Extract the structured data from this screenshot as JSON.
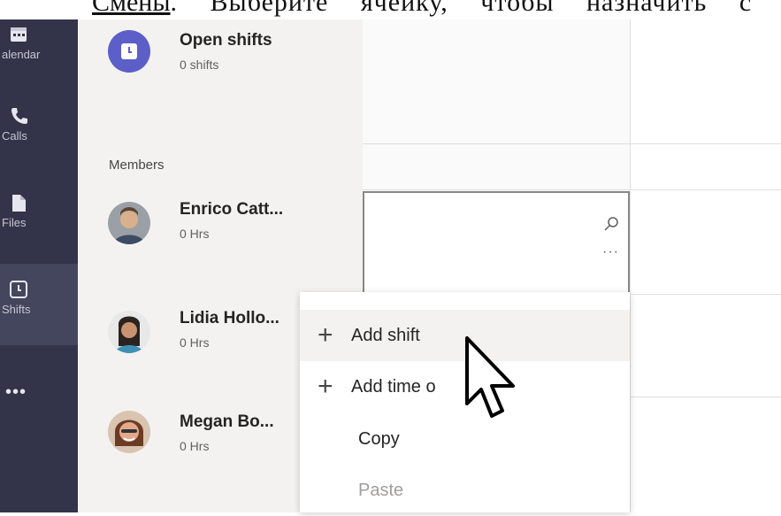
{
  "document": {
    "caption_link": "Смены",
    "caption_rest": ". Выберите ячейку, чтобы назначить с"
  },
  "rail": {
    "items": [
      {
        "label": "alendar",
        "icon": "calendar-icon"
      },
      {
        "label": "Calls",
        "icon": "phone-icon"
      },
      {
        "label": "Files",
        "icon": "file-icon"
      },
      {
        "label": "Shifts",
        "icon": "shifts-clock-icon"
      }
    ],
    "more": "•••"
  },
  "open_shifts": {
    "title": "Open shifts",
    "sub": "0 shifts"
  },
  "members_label": "Members",
  "members": [
    {
      "name": "Enrico Catt...",
      "hours": "0 Hrs"
    },
    {
      "name": "Lidia Hollo...",
      "hours": "0 Hrs"
    },
    {
      "name": "Megan Bo...",
      "hours": "0 Hrs"
    }
  ],
  "cell": {
    "more": "···"
  },
  "context_menu": {
    "items": [
      {
        "label": "Add shift",
        "icon": "plus"
      },
      {
        "label": "Add time o",
        "icon": "plus"
      },
      {
        "label": "Copy",
        "icon": ""
      },
      {
        "label": "Paste",
        "icon": ""
      }
    ]
  },
  "colors": {
    "rail_bg": "#33344a",
    "open_shift_icon": "#5b5fc7",
    "panel_bg": "#f3f2f1"
  }
}
